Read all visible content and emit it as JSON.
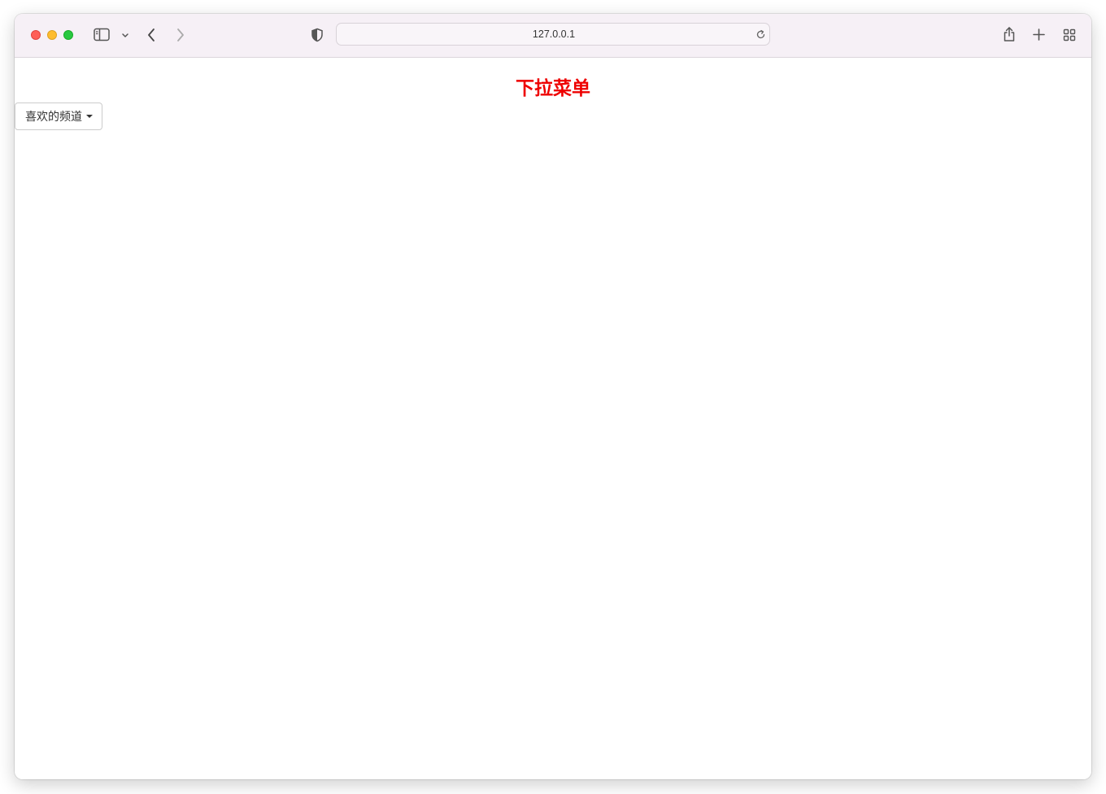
{
  "browser": {
    "url": "127.0.0.1",
    "icons": {
      "close": "close-window-icon",
      "minimize": "minimize-window-icon",
      "zoom": "zoom-window-icon",
      "sidebar": "sidebar-icon",
      "sidebar_menu": "chevron-down-icon",
      "back": "back-arrow-icon",
      "forward": "forward-arrow-icon",
      "privacy": "shield-icon",
      "reload": "reload-icon",
      "share": "share-icon",
      "new_tab": "plus-icon",
      "tab_overview": "grid-icon"
    },
    "colors": {
      "toolbar_bg": "#f6f0f6",
      "close": "#fe5f57",
      "minimize": "#febc2e",
      "zoom": "#28c840"
    }
  },
  "page": {
    "title": "下拉菜单",
    "title_color": "#ee0000",
    "dropdown": {
      "label": "喜欢的频道"
    }
  }
}
